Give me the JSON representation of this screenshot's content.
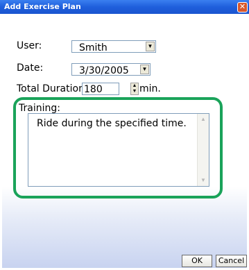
{
  "window": {
    "title": "Add Exercise Plan"
  },
  "form": {
    "user_label": "User:",
    "user_value": "Smith",
    "date_label": "Date:",
    "date_value": "3/30/2005",
    "duration_label": "Total Duration",
    "duration_value": "180",
    "duration_unit": "min.",
    "training_label": "Training:",
    "training_text": "Ride during the specified time."
  },
  "buttons": {
    "ok": "OK",
    "cancel": "Cancel"
  },
  "icons": {
    "close": "close-icon",
    "dropdown": "chevron-down-icon",
    "spin": "spinner-icon",
    "scroll_up": "scroll-up-icon",
    "scroll_down": "scroll-down-icon"
  },
  "colors": {
    "title_bar": "#1f5fdc",
    "highlight": "#1aa35a",
    "close": "#d9582c"
  }
}
